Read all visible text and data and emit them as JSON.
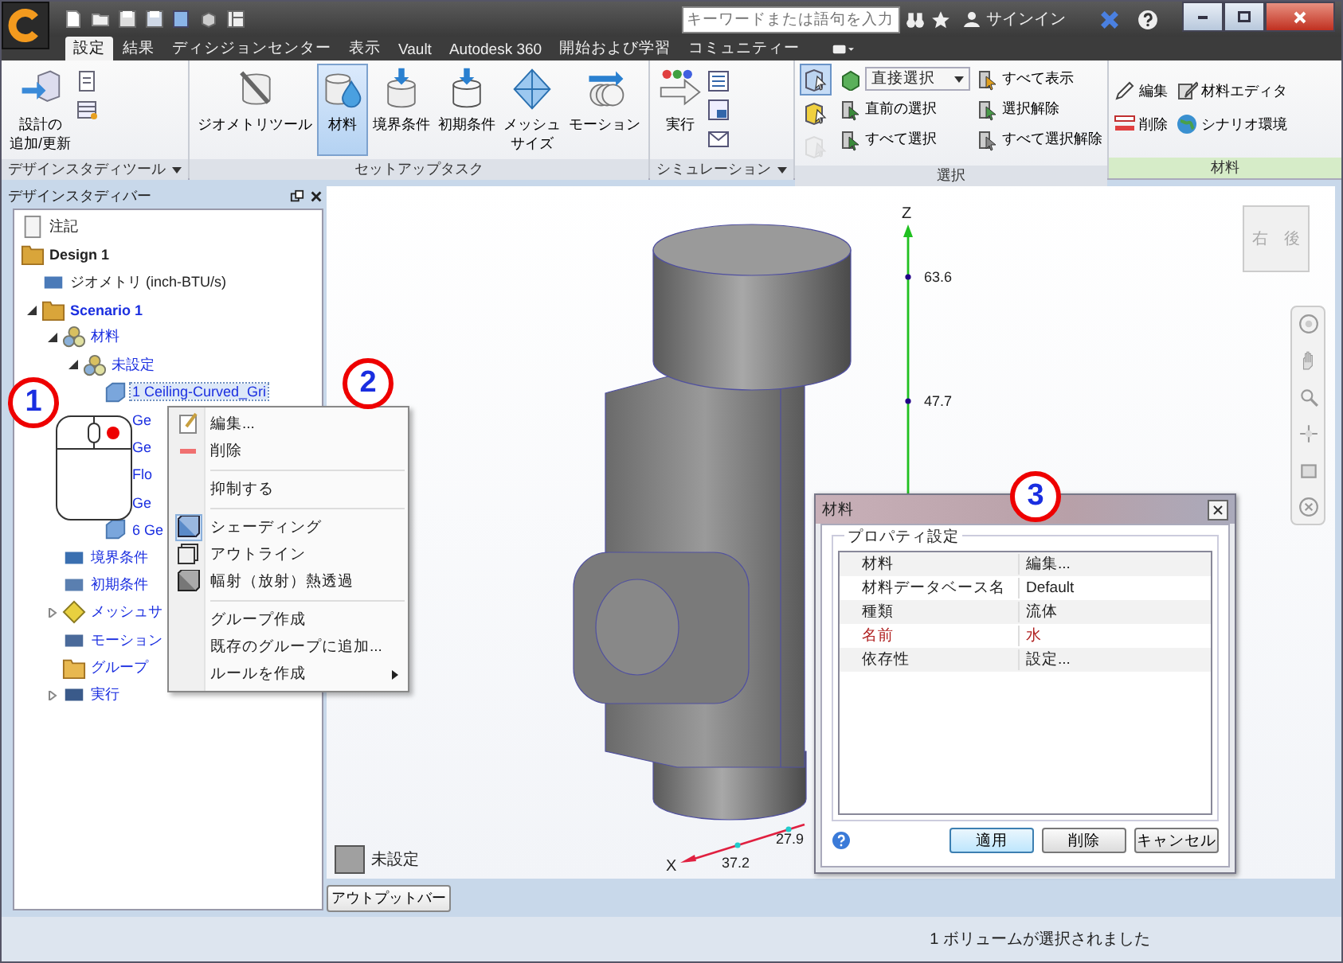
{
  "title_bar": {
    "search": {
      "placeholder": "キーワードまたは語句を入力"
    },
    "sign_in": "サインイン"
  },
  "tabs": [
    {
      "label": "設定",
      "selected": true
    },
    {
      "label": "結果",
      "selected": false
    },
    {
      "label": "ディシジョンセンター",
      "selected": false
    },
    {
      "label": "表示",
      "selected": false
    },
    {
      "label": "Vault",
      "selected": false
    },
    {
      "label": "Autodesk 360",
      "selected": false
    },
    {
      "label": "開始および学習",
      "selected": false
    },
    {
      "label": "コミュニティー",
      "selected": false
    }
  ],
  "ribbon": {
    "design": {
      "title": "デザインスタディツール",
      "dropdown": true,
      "button": [
        "設計の",
        "追加/更新"
      ]
    },
    "setup": {
      "title": "セットアップタスク",
      "buttons": [
        {
          "lines": [
            "ジオメトリツール"
          ],
          "selected": false
        },
        {
          "lines": [
            "材料"
          ],
          "selected": true
        },
        {
          "lines": [
            "境界条件"
          ],
          "selected": false
        },
        {
          "lines": [
            "初期条件"
          ],
          "selected": false
        },
        {
          "lines": [
            "メッシュ",
            "サイズ"
          ],
          "selected": false
        },
        {
          "lines": [
            "モーション"
          ],
          "selected": false
        }
      ]
    },
    "simulation": {
      "title": "シミュレーション",
      "dropdown": true,
      "button": "実行"
    },
    "selection": {
      "title": "選択",
      "modes": [
        {
          "selected": true,
          "disabled": false
        },
        {
          "selected": false,
          "disabled": false
        },
        {
          "selected": false,
          "disabled": true
        }
      ],
      "combo": "直接選択",
      "commands": [
        "直前の選択",
        "すべて選択",
        "すべて表示",
        "選択解除",
        "すべて選択解除"
      ]
    },
    "material": {
      "title": "材料",
      "commands": [
        "編集",
        "削除",
        "材料エディタ",
        "シナリオ環境"
      ]
    }
  },
  "design_study_bar": {
    "title": "デザインスタディバー",
    "tree": [
      {
        "label": "注記",
        "kind": "note"
      },
      {
        "label": "Design 1",
        "kind": "design",
        "children": [
          {
            "label": "ジオメトリ (inch-BTU/s)",
            "kind": "geometry"
          },
          {
            "label": "Scenario 1",
            "kind": "scenario",
            "expanded": true,
            "children": [
              {
                "label": "材料",
                "kind": "material",
                "expanded": true,
                "children": [
                  {
                    "label": "未設定",
                    "kind": "material",
                    "expanded": true,
                    "children": [
                      {
                        "label": "1 Ceiling-Curved_Gri",
                        "kind": "part",
                        "selected": true
                      },
                      {
                        "label": "Ge",
                        "kind": "part",
                        "selected": false
                      },
                      {
                        "label": "Ge",
                        "kind": "part",
                        "selected": false
                      },
                      {
                        "label": "Flo",
                        "kind": "part",
                        "selected": false
                      },
                      {
                        "label": "Ge",
                        "kind": "part",
                        "selected": false
                      },
                      {
                        "label": "6 Ge",
                        "kind": "part",
                        "selected": false
                      }
                    ]
                  }
                ]
              },
              {
                "label": "境界条件",
                "kind": "boundary"
              },
              {
                "label": "初期条件",
                "kind": "initial"
              },
              {
                "label": "メッシュサ",
                "kind": "mesh",
                "expanded": false
              },
              {
                "label": "モーション",
                "kind": "motion"
              },
              {
                "label": "グループ",
                "kind": "group"
              },
              {
                "label": "実行",
                "kind": "run",
                "expanded": false
              }
            ]
          }
        ]
      }
    ]
  },
  "context_menu": [
    {
      "kind": "item",
      "label": "編集..."
    },
    {
      "kind": "item",
      "label": "削除"
    },
    {
      "kind": "separator"
    },
    {
      "kind": "item",
      "label": "抑制する"
    },
    {
      "kind": "separator"
    },
    {
      "kind": "item",
      "label": "シェーディング",
      "checked": true
    },
    {
      "kind": "item",
      "label": "アウトライン",
      "checked": false
    },
    {
      "kind": "item",
      "label": "幅射（放射）熱透過",
      "checked": false
    },
    {
      "kind": "separator"
    },
    {
      "kind": "item",
      "label": "グループ作成"
    },
    {
      "kind": "item",
      "label": "既存のグループに追加..."
    },
    {
      "kind": "item",
      "label": "ルールを作成",
      "submenu": true
    }
  ],
  "viewport": {
    "axis_z": {
      "label": "Z",
      "ticks": [
        "63.6",
        "47.7"
      ]
    },
    "axis_x": {
      "label": "X",
      "ticks": [
        "37.2",
        "27.9"
      ]
    },
    "view_cube": [
      "右",
      "後"
    ],
    "legend": {
      "label": "未設定",
      "color": "#a0a0a0"
    }
  },
  "material_dialog": {
    "title": "材料",
    "group": "プロパティ設定",
    "rows": [
      {
        "name": "材料",
        "value": "編集...",
        "highlighted": false
      },
      {
        "name": "材料データベース名",
        "value": "Default",
        "highlighted": false
      },
      {
        "name": "種類",
        "value": "流体",
        "highlighted": false
      },
      {
        "name": "名前",
        "value": "水",
        "highlighted": true
      },
      {
        "name": "依存性",
        "value": "設定...",
        "highlighted": false
      }
    ],
    "buttons": [
      {
        "label": "適用",
        "default": true
      },
      {
        "label": "削除",
        "default": false
      },
      {
        "label": "キャンセル",
        "default": false
      }
    ]
  },
  "callouts": [
    "1",
    "2",
    "3"
  ],
  "output_bar_button": "アウトプットバー",
  "status_bar": "1 ボリュームが選択されました"
}
